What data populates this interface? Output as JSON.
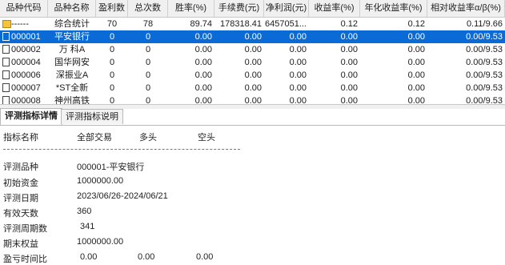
{
  "table": {
    "columns": [
      "品种代码",
      "品种名称",
      "盈利数",
      "总次数",
      "胜率(%)",
      "手续费(元)",
      "净利润(元)",
      "收益率(%)",
      "年化收益率(%)",
      "相对收益率α/β(%)"
    ],
    "rows": [
      {
        "code": "------",
        "name": "综合统计",
        "win": "70",
        "total": "78",
        "rate": "89.74",
        "fee": "178318.41",
        "profit": "6457051...",
        "ret": "0.12",
        "annual": "0.12",
        "rel": "0.11/9.66"
      },
      {
        "code": "000001",
        "name": "平安银行",
        "win": "0",
        "total": "0",
        "rate": "0.00",
        "fee": "0.00",
        "profit": "0.00",
        "ret": "0.00",
        "annual": "0.00",
        "rel": "0.00/9.53"
      },
      {
        "code": "000002",
        "name": "万 科A",
        "win": "0",
        "total": "0",
        "rate": "0.00",
        "fee": "0.00",
        "profit": "0.00",
        "ret": "0.00",
        "annual": "0.00",
        "rel": "0.00/9.53"
      },
      {
        "code": "000004",
        "name": "国华网安",
        "win": "0",
        "total": "0",
        "rate": "0.00",
        "fee": "0.00",
        "profit": "0.00",
        "ret": "0.00",
        "annual": "0.00",
        "rel": "0.00/9.53"
      },
      {
        "code": "000006",
        "name": "深振业A",
        "win": "0",
        "total": "0",
        "rate": "0.00",
        "fee": "0.00",
        "profit": "0.00",
        "ret": "0.00",
        "annual": "0.00",
        "rel": "0.00/9.53"
      },
      {
        "code": "000007",
        "name": "*ST全新",
        "win": "0",
        "total": "0",
        "rate": "0.00",
        "fee": "0.00",
        "profit": "0.00",
        "ret": "0.00",
        "annual": "0.00",
        "rel": "0.00/9.53"
      },
      {
        "code": "000008",
        "name": "神州高铁",
        "win": "0",
        "total": "0",
        "rate": "0.00",
        "fee": "0.00",
        "profit": "0.00",
        "ret": "0.00",
        "annual": "0.00",
        "rel": "0.00/9.53"
      }
    ]
  },
  "tabs": [
    "评测指标详情",
    "评测指标说明"
  ],
  "detail": {
    "headers": [
      "指标名称",
      "全部交易",
      "多头",
      "空头"
    ],
    "items": [
      {
        "label": "评测品种",
        "value": "000001-平安银行"
      },
      {
        "label": "初始资金",
        "value": "1000000.00"
      },
      {
        "label": "评测日期",
        "value": "2023/06/26-2024/06/21"
      },
      {
        "label": "有效天数",
        "value": "360"
      },
      {
        "label": "评测周期数",
        "value": "341"
      },
      {
        "label": "期末权益",
        "value": "1000000.00"
      }
    ],
    "last_row": {
      "label": "盈亏时间比",
      "all": "0.00",
      "long": "0.00",
      "short": "0.00"
    }
  },
  "colors": {
    "selection": "#0a6ad6",
    "folder": "#f5c43a"
  },
  "selected_row_index": 1
}
